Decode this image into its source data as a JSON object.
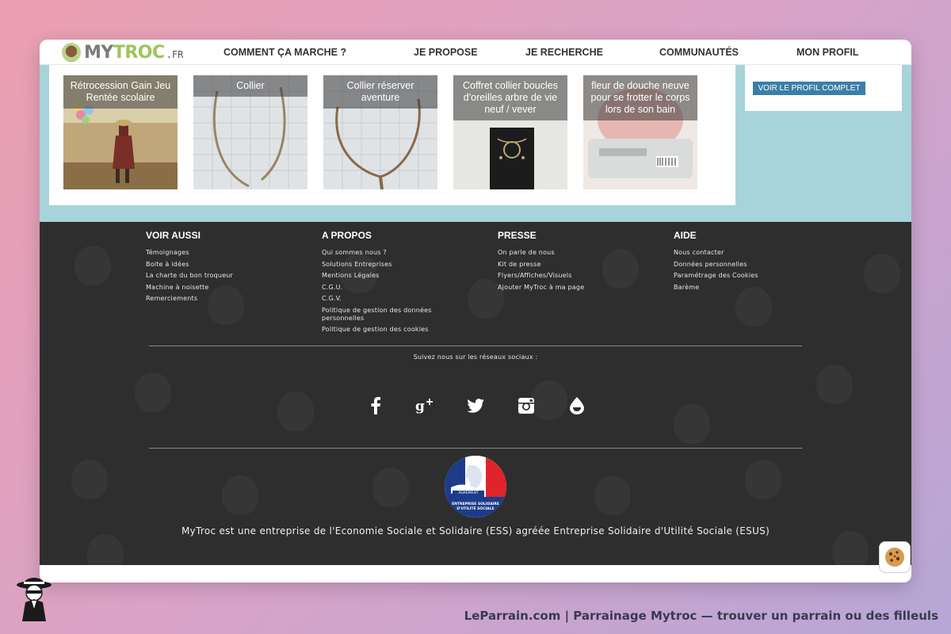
{
  "brand": {
    "logo_my": "MY",
    "logo_troc": "TROC",
    "logo_fr": ".FR"
  },
  "nav": {
    "items": [
      {
        "label": "COMMENT ÇA MARCHE ?"
      },
      {
        "label": "JE PROPOSE"
      },
      {
        "label": "JE RECHERCHE"
      },
      {
        "label": "COMMUNAUTÉS"
      },
      {
        "label": "MON PROFIL"
      }
    ]
  },
  "products": [
    {
      "title": "Rétrocession Gain Jeu Rentée scolaire",
      "image_icon": "woman-balloons-photo"
    },
    {
      "title": "Collier",
      "image_icon": "necklace-photo"
    },
    {
      "title": "Collier réserver aventure",
      "image_icon": "necklace-photo"
    },
    {
      "title": "Coffret collier boucles d'oreilles arbre de vie neuf / vever",
      "image_icon": "jewelry-box-photo"
    },
    {
      "title": "fleur de douche neuve pour se frotter le corps lors de son bain",
      "image_icon": "bath-flower-photo"
    }
  ],
  "profile": {
    "button_label": "VOIR LE PROFIL COMPLET"
  },
  "footer": {
    "columns": [
      {
        "title": "VOIR AUSSI",
        "links": [
          "Témoignages",
          "Boite à idées",
          "La charte du bon troqueur",
          "Machine à noisette",
          "Remerciements"
        ]
      },
      {
        "title": "A PROPOS",
        "links": [
          "Qui sommes nous ?",
          "Solutions Entreprises",
          "Mentions Légales",
          "C.G.U.",
          "C.G.V.",
          "Politique de gestion des données personnelles",
          "Politique de gestion des cookies"
        ]
      },
      {
        "title": "PRESSE",
        "links": [
          "On parle de nous",
          "Kit de presse",
          "Flyers/Affiches/Visuels",
          "Ajouter MyTroc à ma page"
        ]
      },
      {
        "title": "AIDE",
        "links": [
          "Nous contacter",
          "Données personnelles",
          "Paramétrage des Cookies",
          "Barème"
        ]
      }
    ],
    "follow_text": "Suivez nous sur les réseaux sociaux :",
    "social_icons": [
      "facebook-icon",
      "google-plus-icon",
      "twitter-icon",
      "instagram-icon",
      "drop-icon"
    ],
    "esus_badge": {
      "agreement": "AGRÉMENT",
      "line1": "ENTREPRISE SOLIDAIRE",
      "line2": "D'UTILITÉ SOCIALE"
    },
    "ess_text": "MyTroc est une entreprise de l'Economie Sociale et Solidaire (ESS) agréée Entreprise Solidaire d'Utilité Sociale (ESUS)"
  },
  "cookie_icon": "cookie-icon",
  "caption": "LeParrain.com | Parrainage Mytroc — trouver un parrain ou des filleuls",
  "colors": {
    "teal": "#a6d4da",
    "footer_bg": "#2e2e2e",
    "button_blue": "#3b7fa6",
    "logo_green": "#9cc65a"
  }
}
